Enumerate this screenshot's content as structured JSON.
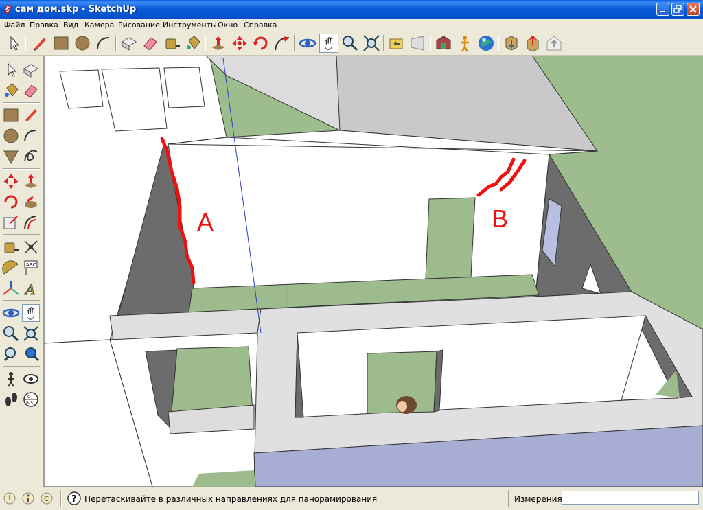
{
  "window": {
    "title": "сам дом.skp - SketchUp"
  },
  "menu": [
    {
      "label": "Файл"
    },
    {
      "label": "Правка"
    },
    {
      "label": "Вид"
    },
    {
      "label": "Камера"
    },
    {
      "label": "Рисование"
    },
    {
      "label": "Инструменты"
    },
    {
      "label": "Окно"
    },
    {
      "label": "Справка"
    }
  ],
  "toolbar_icons": [
    "select-icon",
    "pencil-icon",
    "rectangle-icon",
    "circle-icon",
    "arc-icon",
    "make-component-icon",
    "eraser-icon",
    "tape-measure-icon",
    "paint-bucket-icon",
    "push-pull-icon",
    "move-icon",
    "rotate-icon",
    "follow-me-icon",
    "orbit-icon",
    "pan-icon",
    "zoom-icon",
    "zoom-extents-icon",
    "previous-view-icon",
    "next-view-icon",
    "get-models-icon",
    "place-figure-icon",
    "share-model-icon",
    "google-earth-icon",
    "get-current-view-icon",
    "toggle-terrain-icon",
    "share-component-icon"
  ],
  "sidebar_icons": [
    "select-icon",
    "make-component-icon",
    "paint-bucket-icon",
    "eraser-icon",
    "rectangle-icon",
    "pencil-icon",
    "circle-icon",
    "arc-icon",
    "polygon-icon",
    "freehand-icon",
    "move-icon",
    "push-pull-icon",
    "rotate-icon",
    "follow-me-icon",
    "scale-icon",
    "offset-icon",
    "tape-measure-icon",
    "dimension-icon",
    "protractor-icon",
    "text-icon",
    "axes-icon",
    "3d-text-icon",
    "orbit-icon",
    "pan-icon",
    "zoom-icon",
    "zoom-window-icon",
    "previous-icon",
    "zoom-extents-icon",
    "position-camera-icon",
    "look-around-icon",
    "walk-icon",
    "section-plane-icon"
  ],
  "annotations": {
    "label_a": "A",
    "label_b": "B"
  },
  "colors": {
    "annotation": "#ee1111",
    "ground": "#9ebd8e",
    "wall_dark": "#6c6c6c",
    "floor_green": "#9dbb8c"
  },
  "status": {
    "message": "Перетаскивайте в различных направлениях для панорамирования",
    "measurements_label": "Измерения",
    "measurements_value": ""
  }
}
